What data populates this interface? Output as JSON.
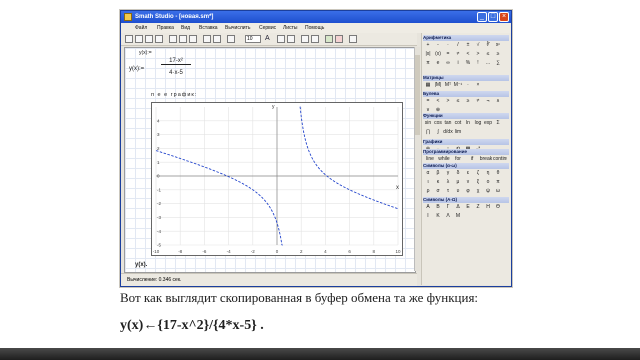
{
  "window": {
    "title": "Smath Studio - [новая.sm*]",
    "controls": [
      "minimize",
      "maximize",
      "close"
    ],
    "close_color": "#d9451b",
    "titlebar_color": "#1e4fcf"
  },
  "menu": [
    "Файл",
    "Правка",
    "Вид",
    "Вставка",
    "Вычислить",
    "Сервис",
    "Листы",
    "Помощь"
  ],
  "toolbar": {
    "zoom_value": "10",
    "font_icon": "A"
  },
  "worksheet": {
    "definition_label": "у(x):=",
    "formula_lhs": "y(x):=",
    "formula_num": "17-x²",
    "formula_den": "4·x-5",
    "graph_label": "п е е график:",
    "graph_var": "у(x).",
    "axis_marker_y": "у",
    "axis_marker_x": "x"
  },
  "chart_data": {
    "type": "line",
    "function": "y(x)=(17-x^2)/(4*x-5)",
    "x_ticks": [
      "-10",
      "-8",
      "-6",
      "-4",
      "-2",
      "0",
      "2",
      "4",
      "6",
      "8",
      "10"
    ],
    "y_ticks": [
      "4",
      "3",
      "2",
      "1",
      "0",
      "-1",
      "-2",
      "-3",
      "-4",
      "-5"
    ],
    "xlim": [
      -10,
      10
    ],
    "ylim": [
      -5,
      5
    ],
    "grid": true,
    "line_style": "dashed",
    "line_color": "#2244cc"
  },
  "status": {
    "text": "Вычисление: 0.346 сек."
  },
  "palettes": [
    {
      "title": "Арифметика",
      "items": [
        "+",
        "-",
        "·",
        "/",
        "±",
        "√",
        "∛",
        "xⁿ",
        "|x|",
        "(x)",
        "=",
        "≠",
        "<",
        ">",
        "≤",
        "≥",
        "π",
        "e",
        "∞",
        "i",
        "%",
        "!",
        "…",
        "∑"
      ]
    },
    {
      "title": "Матрицы",
      "items": [
        "▦",
        "|M|",
        "Mᵀ",
        "M⁻¹",
        "·",
        "×"
      ]
    },
    {
      "title": "Булева",
      "items": [
        "=",
        "<",
        ">",
        "≤",
        "≥",
        "≠",
        "¬",
        "∧",
        "∨",
        "⊕"
      ]
    },
    {
      "title": "Функции",
      "items": [
        "sin",
        "cos",
        "tan",
        "cot",
        "ln",
        "log",
        "exp",
        "Σ",
        "∏",
        "∫",
        "d/dx",
        "lim"
      ]
    },
    {
      "title": "Графики",
      "items": [
        "⊕",
        "↔",
        "↕",
        "⟲",
        "▦",
        "⤢"
      ]
    },
    {
      "title": "Программирование",
      "items": [
        "line",
        "while",
        "for",
        "if",
        "break",
        "continue"
      ]
    },
    {
      "title": "Символы (α-ω)",
      "items": [
        "α",
        "β",
        "γ",
        "δ",
        "ε",
        "ζ",
        "η",
        "θ",
        "ι",
        "κ",
        "λ",
        "μ",
        "ν",
        "ξ",
        "ο",
        "π",
        "ρ",
        "σ",
        "τ",
        "υ",
        "φ",
        "χ",
        "ψ",
        "ω"
      ]
    },
    {
      "title": "Символы (А-Ω)",
      "items": [
        "Α",
        "Β",
        "Γ",
        "Δ",
        "Ε",
        "Ζ",
        "Η",
        "Θ",
        "Ι",
        "Κ",
        "Λ",
        "Μ"
      ]
    }
  ],
  "caption": {
    "line1": "Вот как выглядит скопированная в буфер обмена та же функция:",
    "line2": "y(x)←{17-x^2}/{4*x-5} ."
  }
}
